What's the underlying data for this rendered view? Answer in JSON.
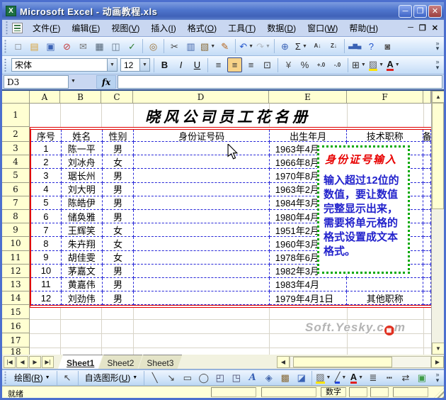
{
  "titlebar": {
    "title": "Microsoft Excel - 动画教程.xls",
    "minimize": "─",
    "restore": "❐",
    "close": "✕"
  },
  "menubar": {
    "items": [
      "文件(F)",
      "编辑(E)",
      "视图(V)",
      "插入(I)",
      "格式(O)",
      "工具(T)",
      "数据(D)",
      "窗口(W)",
      "帮助(H)"
    ],
    "window_controls": {
      "minimize": "─",
      "restore": "❐",
      "close": "✕"
    }
  },
  "standard_toolbar": {
    "icons": [
      {
        "name": "new-document-icon",
        "glyph": "□",
        "color": "#666"
      },
      {
        "name": "open-icon",
        "glyph": "▤",
        "color": "#d9a33c"
      },
      {
        "name": "save-icon",
        "glyph": "▣",
        "color": "#3a62b5"
      },
      {
        "name": "permission-icon",
        "glyph": "⊘",
        "color": "#c43c3c"
      },
      {
        "name": "mail-icon",
        "glyph": "✉",
        "color": "#777777"
      },
      {
        "name": "print-icon",
        "glyph": "▦",
        "color": "#556677"
      },
      {
        "name": "print-preview-icon",
        "glyph": "◫",
        "color": "#667788"
      },
      {
        "name": "spelling-icon",
        "glyph": "✓",
        "color": "#2f7d32"
      },
      {
        "name": "research-icon",
        "glyph": "◎",
        "color": "#9c6f2f",
        "sep_before": true
      },
      {
        "name": "cut-icon",
        "glyph": "✂",
        "color": "#444444",
        "sep_before": true
      },
      {
        "name": "copy-icon",
        "glyph": "▥",
        "color": "#4466aa"
      },
      {
        "name": "paste-icon",
        "glyph": "▧",
        "color": "#8a6d3b",
        "dropdown": true
      },
      {
        "name": "format-painter-icon",
        "glyph": "✎",
        "color": "#b5651d"
      },
      {
        "name": "undo-icon",
        "glyph": "↶",
        "color": "#2255cc",
        "dropdown": true,
        "sep_before": true
      },
      {
        "name": "redo-icon",
        "glyph": "↷",
        "color": "#888888",
        "dropdown": true,
        "disabled": true
      },
      {
        "name": "hyperlink-icon",
        "glyph": "⊕",
        "color": "#3a62b5",
        "sep_before": true
      },
      {
        "name": "autosum-icon",
        "glyph": "Σ",
        "color": "#222222",
        "dropdown": true
      },
      {
        "name": "sort-ascending-icon",
        "glyph": "A↓",
        "color": "#333333",
        "small": true
      },
      {
        "name": "sort-descending-icon",
        "glyph": "Z↓",
        "color": "#333333",
        "small": true
      },
      {
        "name": "chart-wizard-icon",
        "glyph": "▃▆▄",
        "color": "#3a62b5",
        "small": true,
        "sep_before": true
      },
      {
        "name": "help-icon",
        "glyph": "?",
        "color": "#2255cc"
      },
      {
        "name": "camera-icon",
        "glyph": "◙",
        "color": "#555555"
      }
    ]
  },
  "format_toolbar": {
    "font_name": "宋体",
    "font_size": "12",
    "icons": [
      {
        "name": "bold-icon",
        "glyph": "B",
        "color": "#111",
        "bold": true,
        "sep_before": true
      },
      {
        "name": "italic-icon",
        "glyph": "I",
        "color": "#111",
        "italic": true
      },
      {
        "name": "underline-icon",
        "glyph": "U",
        "color": "#111",
        "underline_text": true
      },
      {
        "name": "align-left-icon",
        "glyph": "≡",
        "color": "#333",
        "sep_before": true
      },
      {
        "name": "align-center-icon",
        "glyph": "≡",
        "color": "#333",
        "active": true
      },
      {
        "name": "align-right-icon",
        "glyph": "≡",
        "color": "#333"
      },
      {
        "name": "merge-center-icon",
        "glyph": "⊡",
        "color": "#333"
      },
      {
        "name": "currency-icon",
        "glyph": "¥",
        "color": "#555",
        "sep_before": true
      },
      {
        "name": "percent-icon",
        "glyph": "%",
        "color": "#333"
      },
      {
        "name": "increase-decimal-icon",
        "glyph": "+.0",
        "color": "#333",
        "small": true
      },
      {
        "name": "decrease-decimal-icon",
        "glyph": "-.0",
        "color": "#333",
        "small": true
      },
      {
        "name": "borders-icon",
        "glyph": "⊞",
        "color": "#333",
        "dropdown": true,
        "sep_before": true
      },
      {
        "name": "fill-color-icon",
        "glyph": "▨",
        "color": "#666",
        "underline": "#ffe400",
        "dropdown": true
      },
      {
        "name": "font-color-icon",
        "glyph": "A",
        "color": "#111",
        "underline": "#e02020",
        "dropdown": true,
        "bold": true
      }
    ]
  },
  "formula_bar": {
    "cell_ref": "D3",
    "fx_label": "fx"
  },
  "grid": {
    "columns": [
      "A",
      "B",
      "C",
      "D",
      "E",
      "F"
    ],
    "row_numbers": [
      "1",
      "2",
      "3",
      "4",
      "5",
      "6",
      "7",
      "8",
      "9",
      "10",
      "11",
      "12",
      "13",
      "14",
      "15",
      "16",
      "17",
      "18"
    ]
  },
  "table": {
    "title": "晓风公司员工花名册",
    "headers": [
      "序号",
      "姓名",
      "性别",
      "身份证号码",
      "出生年月",
      "技术职称",
      "备"
    ],
    "rows": [
      {
        "no": "1",
        "name": "陈一平",
        "gender": "男",
        "id": "",
        "birth": "1963年4月",
        "title": "",
        "remark": ""
      },
      {
        "no": "2",
        "name": "刘冰舟",
        "gender": "女",
        "id": "",
        "birth": "1966年8月",
        "title": "",
        "remark": ""
      },
      {
        "no": "3",
        "name": "琚长州",
        "gender": "男",
        "id": "",
        "birth": "1970年8月",
        "title": "",
        "remark": ""
      },
      {
        "no": "4",
        "name": "刘大明",
        "gender": "男",
        "id": "",
        "birth": "1963年2月",
        "title": "",
        "remark": ""
      },
      {
        "no": "5",
        "name": "陈皓伊",
        "gender": "男",
        "id": "",
        "birth": "1984年3月",
        "title": "",
        "remark": ""
      },
      {
        "no": "6",
        "name": "储奂雅",
        "gender": "男",
        "id": "",
        "birth": "1980年4月",
        "title": "",
        "remark": ""
      },
      {
        "no": "7",
        "name": "王辉笑",
        "gender": "女",
        "id": "",
        "birth": "1951年2月",
        "title": "",
        "remark": ""
      },
      {
        "no": "8",
        "name": "朱卉翔",
        "gender": "女",
        "id": "",
        "birth": "1960年3月",
        "title": "",
        "remark": ""
      },
      {
        "no": "9",
        "name": "胡佳雯",
        "gender": "女",
        "id": "",
        "birth": "1978年6月",
        "title": "",
        "remark": ""
      },
      {
        "no": "10",
        "name": "茅嘉文",
        "gender": "男",
        "id": "",
        "birth": "1982年3月",
        "title": "",
        "remark": ""
      },
      {
        "no": "11",
        "name": "黄嘉伟",
        "gender": "男",
        "id": "",
        "birth": "1983年4月",
        "title": "",
        "remark": ""
      },
      {
        "no": "12",
        "name": "刘劲伟",
        "gender": "男",
        "id": "",
        "birth": "1979年4月1日",
        "title": "其他职称",
        "remark": ""
      }
    ]
  },
  "callout": {
    "title": "身份证号输入",
    "body": "输入超过12位的数值，要让数值完整显示出来，需要将单元格的格式设置成文本格式。"
  },
  "watermark": {
    "prefix": "Soft.Yesky.c",
    "dot": "▦",
    "suffix": "m"
  },
  "sheet_tabs": {
    "tabs": [
      "Sheet1",
      "Sheet2",
      "Sheet3"
    ],
    "active_index": 0,
    "nav": [
      "|◀",
      "◀",
      "▶",
      "▶|"
    ]
  },
  "drawing_toolbar": {
    "draw_label": "绘图(R)",
    "autoshapes_label": "自选图形(U)",
    "icons": [
      {
        "name": "select-objects-icon",
        "glyph": "↖",
        "color": "#444",
        "sep_before": true
      },
      {
        "name": "line-icon",
        "glyph": "╲",
        "color": "#444",
        "sep_before": true
      },
      {
        "name": "arrow-icon",
        "glyph": "↘",
        "color": "#444"
      },
      {
        "name": "rectangle-icon",
        "glyph": "▭",
        "color": "#444"
      },
      {
        "name": "oval-icon",
        "glyph": "◯",
        "color": "#444"
      },
      {
        "name": "textbox-icon",
        "glyph": "◰",
        "color": "#446"
      },
      {
        "name": "vertical-textbox-icon",
        "glyph": "◳",
        "color": "#446"
      },
      {
        "name": "wordart-icon",
        "glyph": "A",
        "color": "#3a62b5",
        "wordart": true
      },
      {
        "name": "diagram-icon",
        "glyph": "◈",
        "color": "#4466aa"
      },
      {
        "name": "clipart-icon",
        "glyph": "▩",
        "color": "#8a6d3b"
      },
      {
        "name": "insert-picture-icon",
        "glyph": "◪",
        "color": "#3a62b5"
      },
      {
        "name": "fill-color-icon",
        "glyph": "▨",
        "color": "#666",
        "underline": "#ffe400",
        "dropdown": true,
        "sep_before": true
      },
      {
        "name": "line-color-icon",
        "glyph": "╱",
        "color": "#444",
        "underline": "#2244dd",
        "dropdown": true
      },
      {
        "name": "font-color-icon",
        "glyph": "A",
        "color": "#111",
        "underline": "#e02020",
        "dropdown": true,
        "bold": true
      },
      {
        "name": "line-style-icon",
        "glyph": "≣",
        "color": "#333"
      },
      {
        "name": "dash-style-icon",
        "glyph": "┅",
        "color": "#333"
      },
      {
        "name": "arrow-style-icon",
        "glyph": "⇄",
        "color": "#333"
      },
      {
        "name": "shadow-style-icon",
        "glyph": "▣",
        "color": "#3f9c47"
      }
    ]
  },
  "statusbar": {
    "ready": "就绪",
    "num_indicator": "数字"
  },
  "colors": {
    "table_border": "#e00000",
    "inner_border": "#2828d8",
    "callout_border": "#00a800",
    "callout_title": "#e80000",
    "callout_body": "#2222cc",
    "header_fill": "#ffffd2"
  }
}
